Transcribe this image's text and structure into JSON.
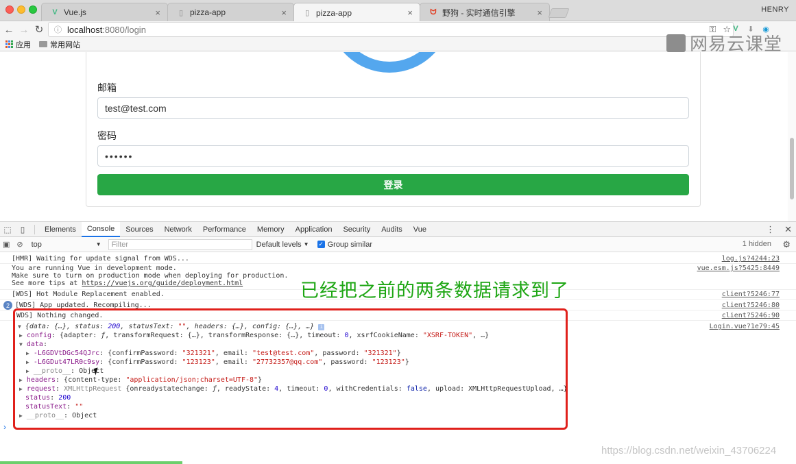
{
  "browser": {
    "tabs": [
      {
        "title": "Vue.js",
        "icon": "vue-icon",
        "active": false
      },
      {
        "title": "pizza-app",
        "icon": "page-icon",
        "active": false
      },
      {
        "title": "pizza-app",
        "icon": "page-icon",
        "active": true
      },
      {
        "title": "野狗 - 实时通信引擎",
        "icon": "wilddog-icon",
        "active": false
      }
    ],
    "profile": "HENRY",
    "url_host": "localhost",
    "url_rest": ":8080/login",
    "bookmarks": [
      {
        "label": "应用",
        "icon": "apps-grid-icon"
      },
      {
        "label": "常用网站",
        "icon": "folder-icon"
      }
    ],
    "watermark": "网易云课堂"
  },
  "form": {
    "email_label": "邮箱",
    "email_value": "test@test.com",
    "password_label": "密码",
    "password_value": "••••••",
    "login_button": "登录",
    "accent": "#28a745"
  },
  "devtools": {
    "tabs": [
      "Elements",
      "Console",
      "Sources",
      "Network",
      "Performance",
      "Memory",
      "Application",
      "Security",
      "Audits",
      "Vue"
    ],
    "active_tab": "Console",
    "context": "top",
    "filter_placeholder": "Filter",
    "levels": "Default levels",
    "group_similar": "Group similar",
    "hidden": "1 hidden",
    "messages": {
      "m1": "[HMR] Waiting for update signal from WDS...",
      "m1_src": "log.js?4244:23",
      "m2a": "You are running Vue in development mode.",
      "m2b": "Make sure to turn on production mode when deploying for production.",
      "m2c_prefix": "See more tips at ",
      "m2c_link": "https://vuejs.org/guide/deployment.html",
      "m2_src": "vue.esm.js?5425:8449",
      "m3": "[WDS] Hot Module Replacement enabled.",
      "m3_src": "client?5246:77",
      "m4_count": "2",
      "m4": "[WDS] App updated. Recompiling...",
      "m4_src": "client?5246:80",
      "m5": "WDS] Nothing changed.",
      "m5_src": "client?5246:90",
      "obj_src": "Login.vue?1e79:45"
    }
  },
  "annotation": "已经把之前的两条数据请求到了",
  "csdn_watermark": "https://blog.csdn.net/weixin_43706224"
}
